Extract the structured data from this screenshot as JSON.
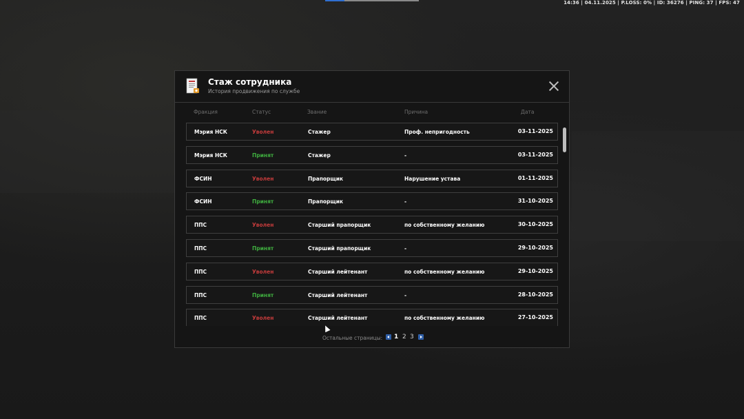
{
  "hud": {
    "status": "14:36 | 04.11.2025 | P.LOSS: 0% | ID: 36276 | PING: 37 | FPS: 47"
  },
  "modal": {
    "title": "Стаж сотрудника",
    "subtitle": "История продвижения по службе",
    "icon": "document-certificate-icon"
  },
  "columns": {
    "faction": "Фракция",
    "status": "Статус",
    "rank": "Звание",
    "reason": "Причина",
    "date": "Дата"
  },
  "rows": [
    {
      "faction": "Мэрия НСК",
      "status": "Уволен",
      "status_type": "fired",
      "rank": "Стажер",
      "reason": "Проф. непригодность",
      "date": "03-11-2025"
    },
    {
      "faction": "Мэрия НСК",
      "status": "Принят",
      "status_type": "hired",
      "rank": "Стажер",
      "reason": "-",
      "date": "03-11-2025"
    },
    {
      "faction": "ФСИН",
      "status": "Уволен",
      "status_type": "fired",
      "rank": "Прапорщик",
      "reason": "Нарушение устава",
      "date": "01-11-2025"
    },
    {
      "faction": "ФСИН",
      "status": "Принят",
      "status_type": "hired",
      "rank": "Прапорщик",
      "reason": "-",
      "date": "31-10-2025"
    },
    {
      "faction": "ППС",
      "status": "Уволен",
      "status_type": "fired",
      "rank": "Старший прапорщик",
      "reason": "по собственному желанию",
      "date": "30-10-2025"
    },
    {
      "faction": "ППС",
      "status": "Принят",
      "status_type": "hired",
      "rank": "Старший прапорщик",
      "reason": "-",
      "date": "29-10-2025"
    },
    {
      "faction": "ППС",
      "status": "Уволен",
      "status_type": "fired",
      "rank": "Старший лейтенант",
      "reason": "по собственному желанию",
      "date": "29-10-2025"
    },
    {
      "faction": "ППС",
      "status": "Принят",
      "status_type": "hired",
      "rank": "Старший лейтенант",
      "reason": "-",
      "date": "28-10-2025"
    },
    {
      "faction": "ППС",
      "status": "Уволен",
      "status_type": "fired",
      "rank": "Старший лейтенант",
      "reason": "по собственному желанию",
      "date": "27-10-2025"
    }
  ],
  "pagination": {
    "label": "Остальные страницы:",
    "pages": [
      "1",
      "2",
      "3"
    ],
    "current": "1"
  },
  "colors": {
    "fired": "#c33b3b",
    "hired": "#3fae3f",
    "accent": "#2f5fa8"
  }
}
